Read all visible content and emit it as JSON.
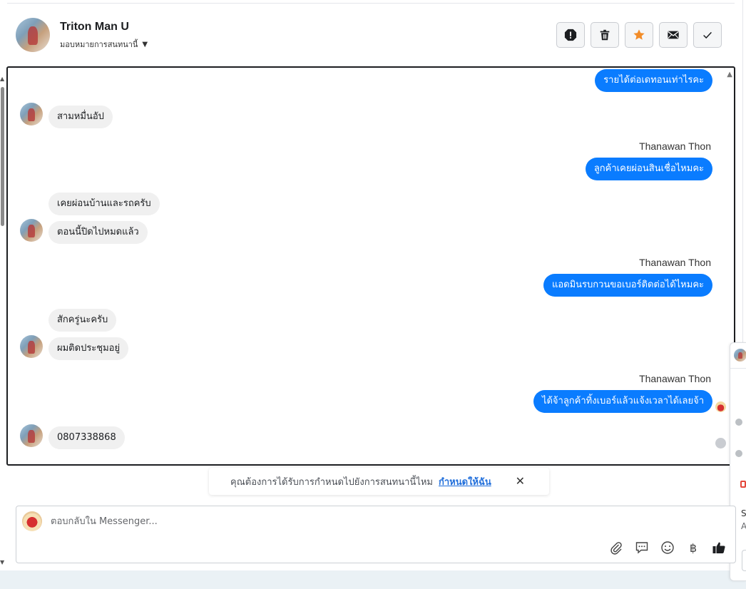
{
  "header": {
    "name": "Triton Man U",
    "assign_label": "มอบหมายการสนทนานี้",
    "actions": [
      "mark-spam",
      "delete",
      "star",
      "mark-unread",
      "mark-done"
    ]
  },
  "messages": {
    "m1": "รายได้ต่อเดทอนเท่าไรคะ",
    "m2": "สามหมื่นอัป",
    "s1": "Thanawan Thon",
    "m3": "ลูกค้าเคยผ่อนสินเชื่อไหมคะ",
    "m4": "เคยผ่อนบ้านและรถครับ",
    "m5": "ตอนนี้ปิดไปหมดแล้ว",
    "s2": "Thanawan Thon",
    "m6": "แอดมินรบกวนขอเบอร์ติดต่อได้ไหมคะ",
    "m7": "สักครู่นะครับ",
    "m8": "ผมติดประชุมอยู่",
    "s3": "Thanawan Thon",
    "m9": "ได้จ้าลูกค้าทิ้งเบอร์แล้วแจ้งเวลาได้เลยจ้า",
    "m10": "0807338868"
  },
  "banner": {
    "text": "คุณต้องการได้รับการกำหนดไปยังการสนทนานี้ไหม",
    "link": "กำหนดให้ฉัน"
  },
  "composer": {
    "placeholder": "ตอบกลับใน Messenger...",
    "value": "",
    "tools": [
      "paperclip-icon",
      "chat-bubble-icon",
      "emoji-icon",
      "baht-icon",
      "thumbs-up-icon"
    ],
    "baht_symbol": "฿"
  },
  "side_panel": {
    "letter_s": "S",
    "letter_a": "A"
  },
  "colors": {
    "outgoing": "#0a7cff",
    "incoming": "#f0f0f0",
    "star": "#f28c28",
    "link": "#216fdb"
  }
}
